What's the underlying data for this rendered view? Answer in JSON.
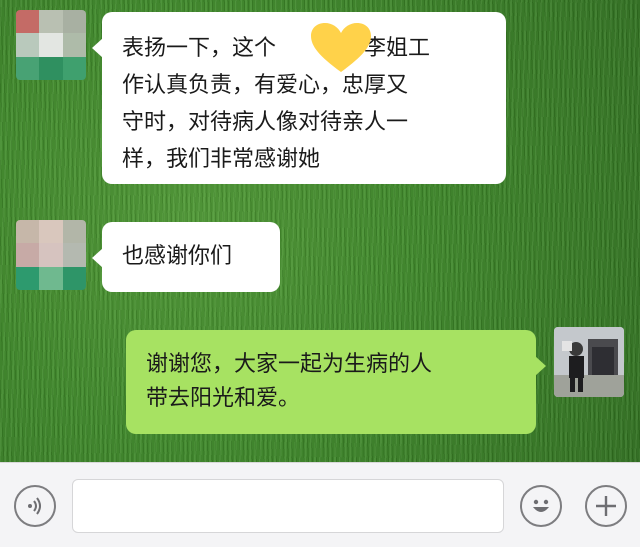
{
  "messages": [
    {
      "side": "left",
      "text_lines": [
        "表扬一下，这个",
        "，李姐工",
        "作认真负责，有爱心，忠厚又",
        "守时，对待病人像对待亲人一",
        "样，我们非常感谢她"
      ]
    },
    {
      "side": "left",
      "text": "也感谢你们"
    },
    {
      "side": "right",
      "text_lines": [
        "谢谢您，大家一起为生病的人",
        "带去阳光和爱。"
      ]
    }
  ],
  "sticker": {
    "icon": "heart-icon",
    "color": "#ffd24a"
  },
  "avatars": {
    "mosaic_1": [
      "#c46b66",
      "#b9c0b2",
      "#a8b0a2",
      "#b9c9bc",
      "#e3e6e2",
      "#aebba9",
      "#48a274",
      "#2f9060",
      "#3fa06e"
    ],
    "mosaic_2": [
      "#c6b7a9",
      "#d9c7bd",
      "#b2b6a8",
      "#c7aaa6",
      "#d6c3bf",
      "#b4b9b0",
      "#2d9a6e",
      "#6fb98f",
      "#2e9568"
    ]
  },
  "input_bar": {
    "voice_icon": "voice-icon",
    "emoji_icon": "emoji-icon",
    "plus_icon": "plus-icon",
    "placeholder": ""
  }
}
